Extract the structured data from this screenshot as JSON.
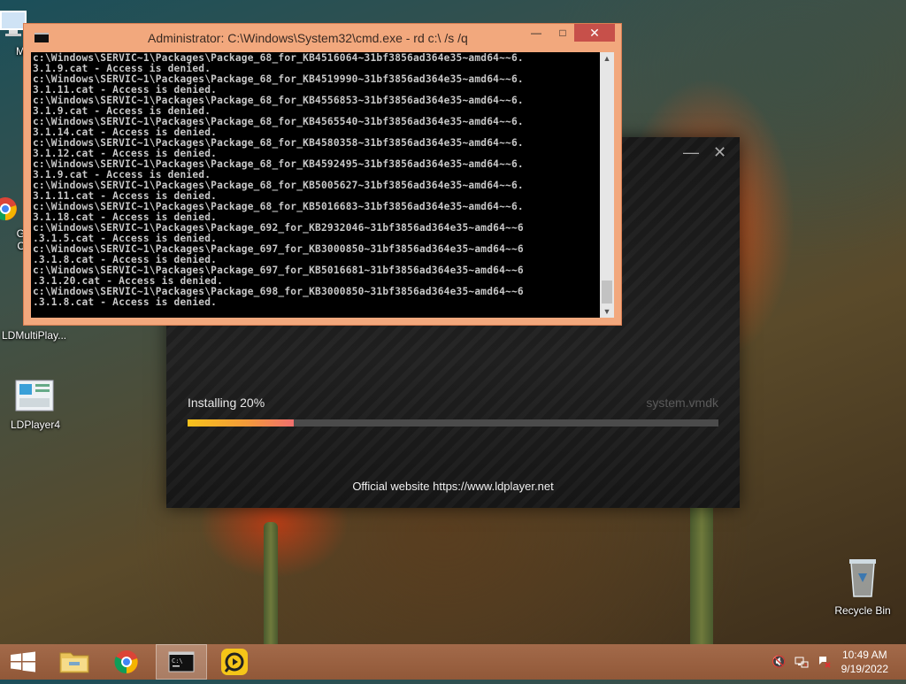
{
  "desktop": {
    "icons": [
      {
        "label": "My C"
      },
      {
        "label": "G"
      },
      {
        "label": "C"
      },
      {
        "label": "LDMultiPlay..."
      },
      {
        "label": "LDPlayer4"
      },
      {
        "label": "Recycle Bin"
      }
    ]
  },
  "installer": {
    "minimize_glyph": "—",
    "close_glyph": "✕",
    "status": "Installing 20%",
    "progress_percent": 20,
    "current_file": "system.vmdk",
    "website": "Official website https://www.ldplayer.net"
  },
  "cmd": {
    "title": "Administrator: C:\\Windows\\System32\\cmd.exe - rd  c:\\ /s /q",
    "minimize_glyph": "—",
    "maximize_glyph": "□",
    "close_glyph": "✕",
    "lines": [
      "c:\\Windows\\SERVIC~1\\Packages\\Package_68_for_KB4516064~31bf3856ad364e35~amd64~~6.",
      "3.1.9.cat - Access is denied.",
      "c:\\Windows\\SERVIC~1\\Packages\\Package_68_for_KB4519990~31bf3856ad364e35~amd64~~6.",
      "3.1.11.cat - Access is denied.",
      "c:\\Windows\\SERVIC~1\\Packages\\Package_68_for_KB4556853~31bf3856ad364e35~amd64~~6.",
      "3.1.9.cat - Access is denied.",
      "c:\\Windows\\SERVIC~1\\Packages\\Package_68_for_KB4565540~31bf3856ad364e35~amd64~~6.",
      "3.1.14.cat - Access is denied.",
      "c:\\Windows\\SERVIC~1\\Packages\\Package_68_for_KB4580358~31bf3856ad364e35~amd64~~6.",
      "3.1.12.cat - Access is denied.",
      "c:\\Windows\\SERVIC~1\\Packages\\Package_68_for_KB4592495~31bf3856ad364e35~amd64~~6.",
      "3.1.9.cat - Access is denied.",
      "c:\\Windows\\SERVIC~1\\Packages\\Package_68_for_KB5005627~31bf3856ad364e35~amd64~~6.",
      "3.1.11.cat - Access is denied.",
      "c:\\Windows\\SERVIC~1\\Packages\\Package_68_for_KB5016683~31bf3856ad364e35~amd64~~6.",
      "3.1.18.cat - Access is denied.",
      "c:\\Windows\\SERVIC~1\\Packages\\Package_692_for_KB2932046~31bf3856ad364e35~amd64~~6",
      ".3.1.5.cat - Access is denied.",
      "c:\\Windows\\SERVIC~1\\Packages\\Package_697_for_KB3000850~31bf3856ad364e35~amd64~~6",
      ".3.1.8.cat - Access is denied.",
      "c:\\Windows\\SERVIC~1\\Packages\\Package_697_for_KB5016681~31bf3856ad364e35~amd64~~6",
      ".3.1.20.cat - Access is denied.",
      "c:\\Windows\\SERVIC~1\\Packages\\Package_698_for_KB3000850~31bf3856ad364e35~amd64~~6",
      ".3.1.8.cat - Access is denied."
    ]
  },
  "taskbar": {
    "buttons": [
      {
        "icon": "windows-start-icon"
      },
      {
        "icon": "file-explorer-icon"
      },
      {
        "icon": "chrome-icon"
      },
      {
        "icon": "cmd-icon"
      },
      {
        "icon": "ldplayer-icon"
      }
    ],
    "tray": {
      "icons": [
        "volume-muted-icon",
        "network-icon",
        "action-center-icon"
      ],
      "time": "10:49 AM",
      "date": "9/19/2022"
    }
  }
}
